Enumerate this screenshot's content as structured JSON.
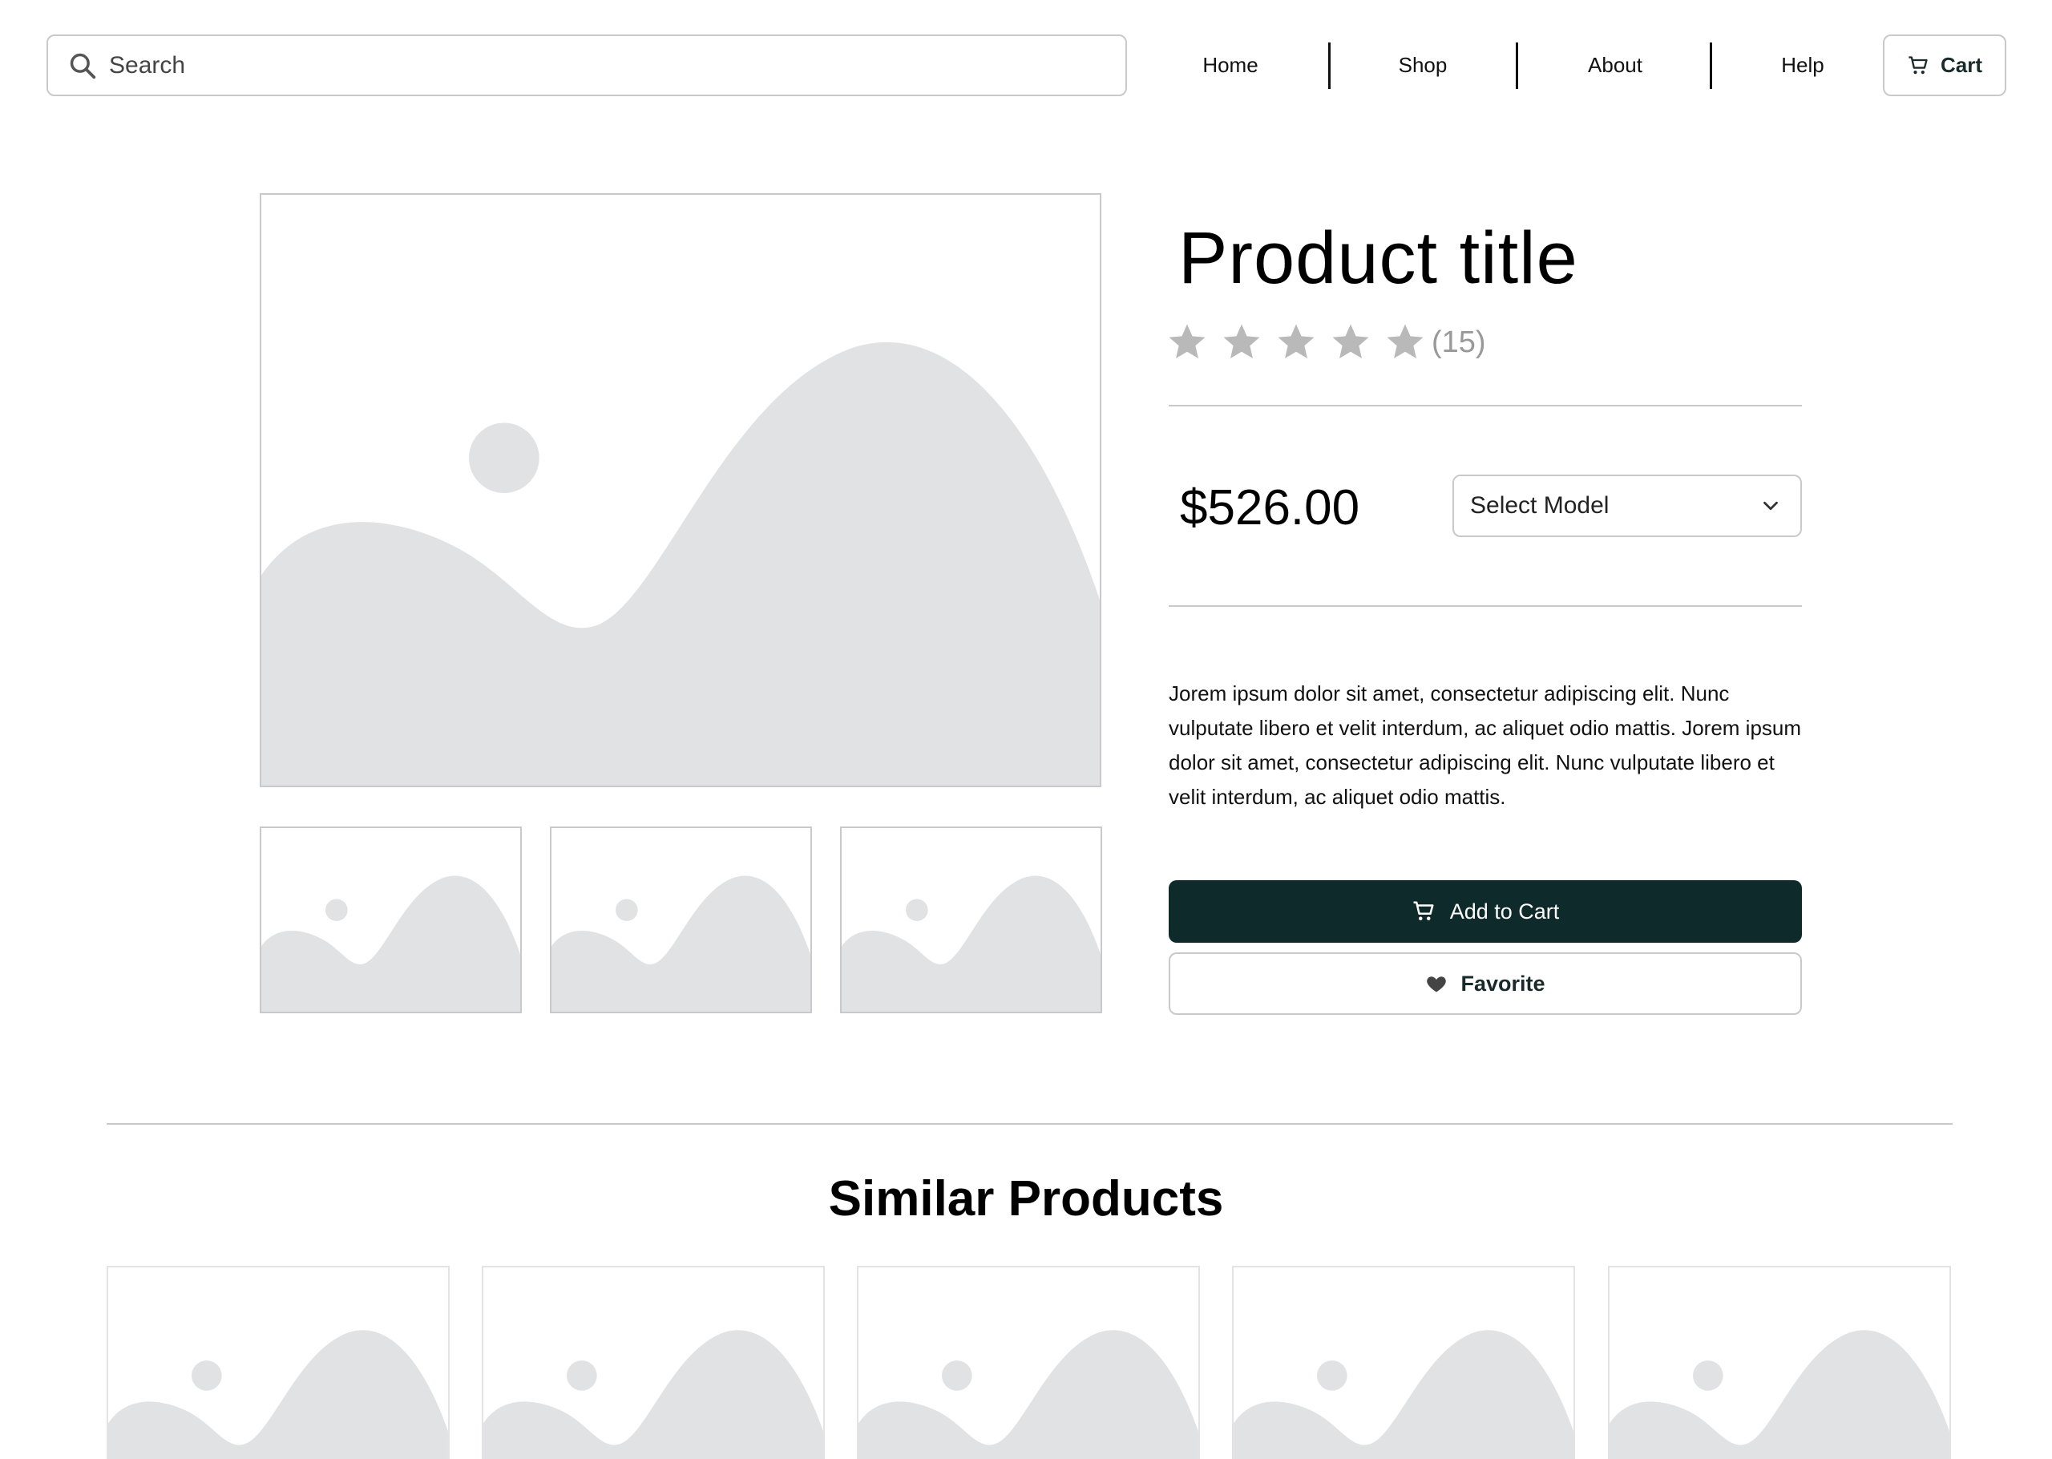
{
  "header": {
    "search_placeholder": "Search",
    "nav": [
      "Home",
      "Shop",
      "About",
      "Help"
    ],
    "cart_label": "Cart"
  },
  "product": {
    "title": "Product title",
    "rating": {
      "stars_filled": 0,
      "stars_total": 5,
      "review_count": "(15)"
    },
    "price": "$526.00",
    "model_select": {
      "selected": "Select Model"
    },
    "description": "Jorem ipsum dolor sit amet, consectetur adipiscing elit. Nunc vulputate libero et velit interdum, ac aliquet odio mattis. Jorem ipsum dolor sit amet, consectetur adipiscing elit. Nunc vulputate libero et velit interdum, ac aliquet odio mattis.",
    "add_to_cart_label": "Add to Cart",
    "favorite_label": "Favorite"
  },
  "similar": {
    "title": "Similar Products"
  },
  "colors": {
    "primary_button": "#0f2a2a",
    "placeholder_fill": "#e1e2e4",
    "border": "#c9c9cc",
    "star": "#b9b9b9"
  },
  "icons": [
    "search-icon",
    "cart-icon",
    "star-icon",
    "chevron-down-icon",
    "heart-icon",
    "image-placeholder-icon"
  ]
}
